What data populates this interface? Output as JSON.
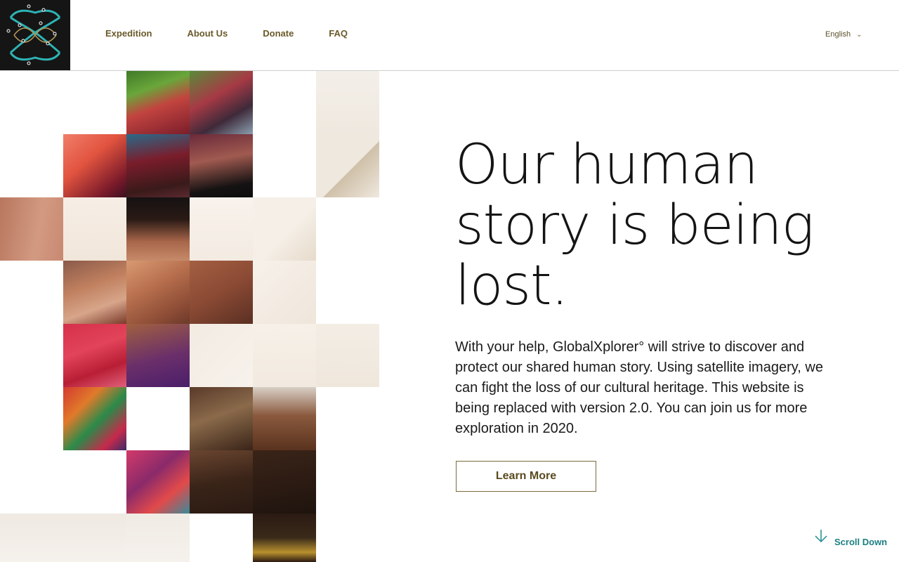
{
  "header": {
    "logo_name": "GlobalXplorer logo",
    "nav": [
      {
        "label": "Expedition"
      },
      {
        "label": "About Us"
      },
      {
        "label": "Donate"
      },
      {
        "label": "FAQ"
      }
    ],
    "language": {
      "selected": "English",
      "icon": "chevron-down-icon"
    }
  },
  "hero": {
    "title": "Our human story is being lost.",
    "body": "With your help, GlobalXplorer° will strive to discover and protect our shared human story. Using satellite imagery, we can fight the loss of our cultural heritage. This website is being replaced with version 2.0. You can join us for more exploration in 2020.",
    "cta_label": "Learn More"
  },
  "scroll": {
    "label": "Scroll Down",
    "icon": "arrow-down-icon"
  },
  "colors": {
    "accent_gold": "#6a5a2a",
    "accent_teal": "#1b7f84",
    "logo_bg": "#151515"
  }
}
